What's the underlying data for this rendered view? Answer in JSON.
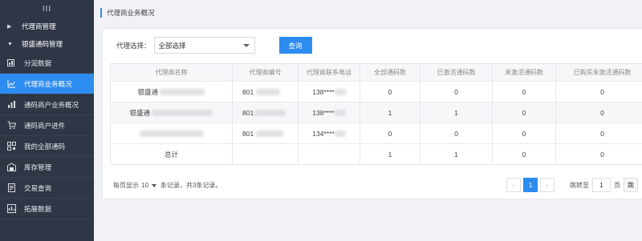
{
  "sidebar": {
    "top_glyph": "III",
    "groups": [
      {
        "label": "代理商管理",
        "arrow": "▶"
      },
      {
        "label": "银盛通码管理",
        "arrow": "▼"
      }
    ],
    "items": [
      {
        "label": "分润数据",
        "icon": "chart-card-icon"
      },
      {
        "label": "代理商业务概况",
        "icon": "trend-chart-icon"
      },
      {
        "label": "通码商户业务概况",
        "icon": "bar-chart-icon"
      },
      {
        "label": "通码商户进件",
        "icon": "cart-icon"
      },
      {
        "label": "我的全部通码",
        "icon": "qr-code-icon"
      },
      {
        "label": "库存管理",
        "icon": "inventory-icon"
      },
      {
        "label": "交易查询",
        "icon": "transaction-icon"
      },
      {
        "label": "拓展数据",
        "icon": "expand-data-icon"
      }
    ]
  },
  "page": {
    "title": "代理商业务概况",
    "accent": "#2d8cf0"
  },
  "filter": {
    "label": "代理选择：",
    "selected": "全部选择",
    "query_button": "查询"
  },
  "table": {
    "headers": [
      "代理商名称",
      "代理商编号",
      "代理商联系电话",
      "全部通码数",
      "已激活通码数",
      "未激活通码数",
      "已购买未激活通码数"
    ],
    "rows": [
      {
        "name": "银盛通",
        "code": "801",
        "phone": "138****",
        "total": "0",
        "activated": "0",
        "inactive": "0",
        "bought_inactive": "0"
      },
      {
        "name": "银盛通",
        "code": "801",
        "phone": "138****",
        "total": "1",
        "activated": "1",
        "inactive": "0",
        "bought_inactive": "0"
      },
      {
        "name": "",
        "code": "801",
        "phone": "134****",
        "total": "0",
        "activated": "0",
        "inactive": "0",
        "bought_inactive": "0"
      }
    ],
    "total_row": {
      "label": "总计",
      "total": "1",
      "activated": "1",
      "inactive": "0",
      "bought_inactive": "0"
    }
  },
  "pagination": {
    "per_page_prefix": "每页显示",
    "per_page_value": "10",
    "per_page_suffix": "条记录，共3条记录。",
    "prev": "‹",
    "current": "1",
    "next": "›",
    "jump_label": "跳转至",
    "jump_value": "1",
    "page_unit": "页",
    "go_label": "跳"
  }
}
